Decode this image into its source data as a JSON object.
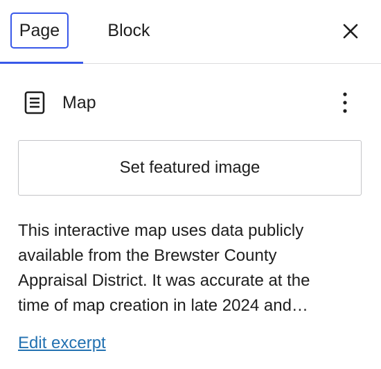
{
  "tabs": {
    "page_label": "Page",
    "block_label": "Block"
  },
  "header": {
    "close_icon": "close-icon"
  },
  "post": {
    "icon": "page-document-icon",
    "title": "Map",
    "more_icon": "more-vertical-icon"
  },
  "featured_image": {
    "button_label": "Set featured image"
  },
  "excerpt": {
    "lines": [
      "This interactive map uses data publicly",
      "available from the Brewster County",
      "Appraisal District. It was accurate at the",
      "time of map creation in late 2024 and…"
    ],
    "edit_label": "Edit excerpt"
  },
  "colors": {
    "accent": "#3858e9",
    "link": "#2271b1",
    "text": "#1e1e1e",
    "border": "#c3c4c7"
  }
}
